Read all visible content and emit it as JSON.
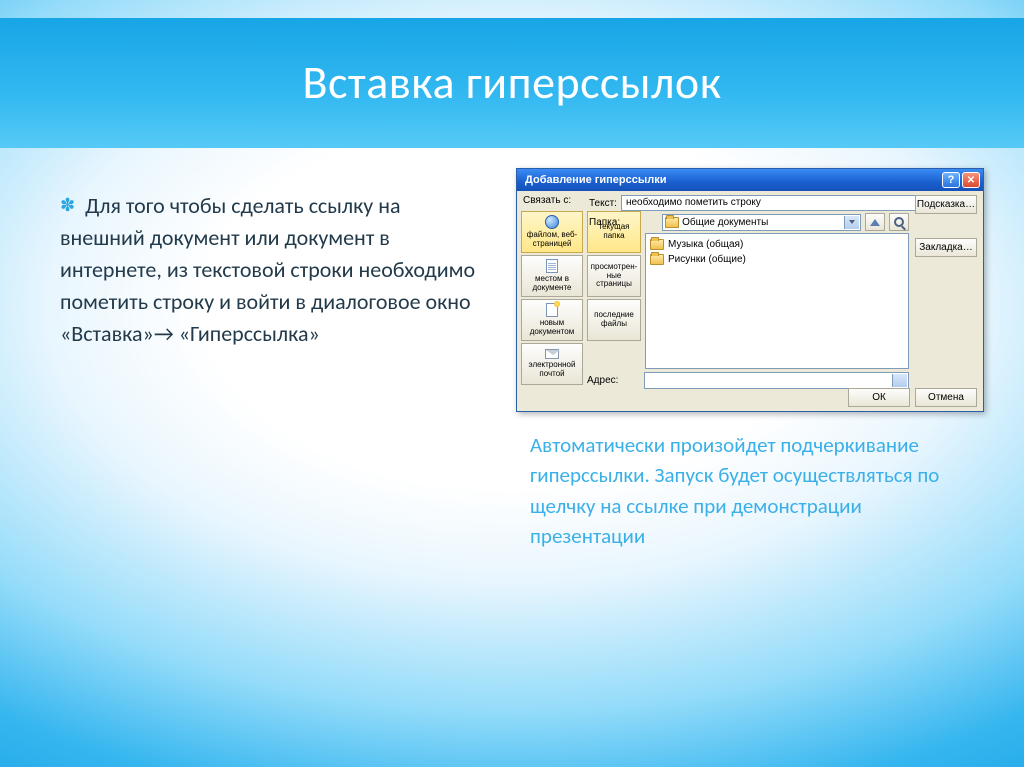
{
  "slide": {
    "title": "Вставка гиперссылок",
    "left_text": "Для того чтобы сделать ссылку на внешний документ или документ в интернете,  из текстовой строки необходимо пометить строку   и войти в диалоговое окно «Вставка»→ «Гиперссылка»",
    "right_text": "Автоматически произойдет подчеркивание гиперссылки. Запуск будет осуществляться по щелчку на ссылке при демонстрации презентации"
  },
  "dialog": {
    "title": "Добавление гиперссылки",
    "connect_label": "Связать с:",
    "text_label": "Текст:",
    "text_value": "необходимо пометить строку",
    "folder_label": "Папка:",
    "folder_value": "Общие документы",
    "address_label": "Адрес:",
    "hint_button": "Подсказка…",
    "bookmark_button": "Закладка…",
    "ok_button": "ОК",
    "cancel_button": "Отмена",
    "places": [
      {
        "label": "файлом, веб-страницей",
        "selected": true
      },
      {
        "label": "местом в документе",
        "selected": false
      },
      {
        "label": "новым документом",
        "selected": false
      },
      {
        "label": "электронной почтой",
        "selected": false
      }
    ],
    "browse": [
      {
        "label": "текущая папка",
        "selected": true
      },
      {
        "label": "просмотрен-ные страницы",
        "selected": false
      },
      {
        "label": "последние файлы",
        "selected": false
      }
    ],
    "files": [
      {
        "name": "Музыка (общая)"
      },
      {
        "name": "Рисунки (общие)"
      }
    ]
  }
}
